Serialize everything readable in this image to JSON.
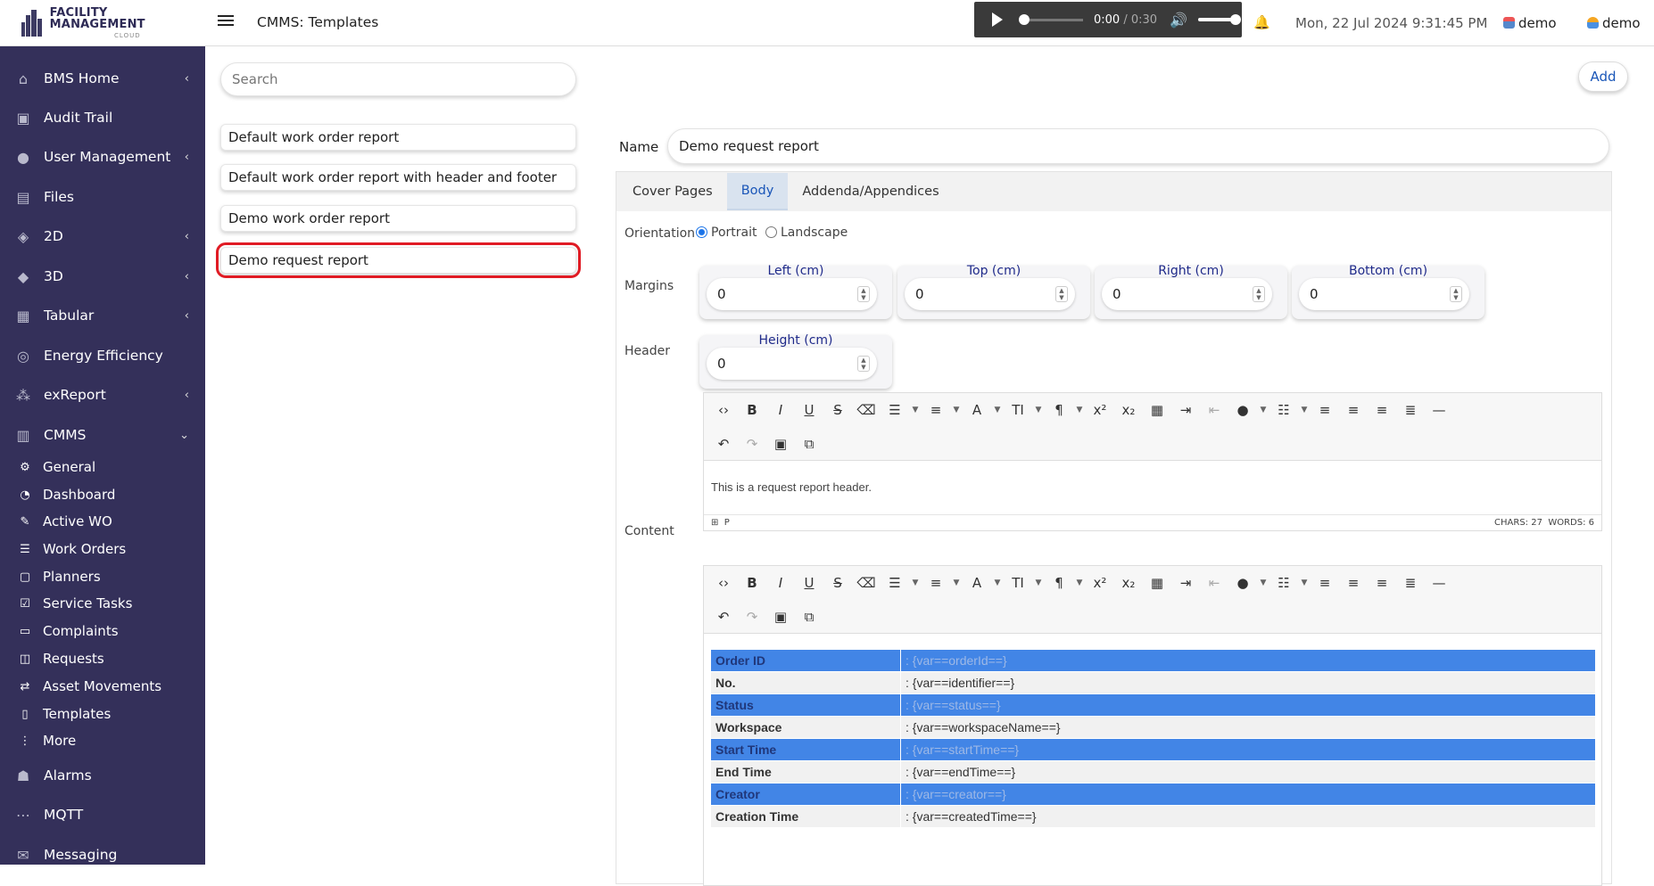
{
  "app": {
    "logo_text": "FACILITY MANAGEMENT",
    "logo_sub": "CLOUD",
    "page_title": "CMMS: Templates"
  },
  "sidebar": {
    "items": [
      {
        "label": "BMS Home",
        "icon": "home-icon",
        "chevron": true
      },
      {
        "label": "Audit Trail",
        "icon": "audit-icon",
        "chevron": false
      },
      {
        "label": "User Management",
        "icon": "users-icon",
        "chevron": true
      },
      {
        "label": "Files",
        "icon": "files-icon",
        "chevron": false
      },
      {
        "label": "2D",
        "icon": "layers-2d-icon",
        "chevron": true
      },
      {
        "label": "3D",
        "icon": "layers-3d-icon",
        "chevron": true
      },
      {
        "label": "Tabular",
        "icon": "table-icon",
        "chevron": true
      },
      {
        "label": "Energy Efficiency",
        "icon": "energy-icon",
        "chevron": false
      },
      {
        "label": "exReport",
        "icon": "report-icon",
        "chevron": true
      },
      {
        "label": "CMMS",
        "icon": "cmms-icon",
        "chevron": true
      }
    ],
    "cmms_sub": [
      {
        "label": "General",
        "icon": "cogs-icon"
      },
      {
        "label": "Dashboard",
        "icon": "dashboard-icon"
      },
      {
        "label": "Active WO",
        "icon": "wrench-icon"
      },
      {
        "label": "Work Orders",
        "icon": "list-icon"
      },
      {
        "label": "Planners",
        "icon": "calendar-icon"
      },
      {
        "label": "Service Tasks",
        "icon": "check-icon"
      },
      {
        "label": "Complaints",
        "icon": "complaint-icon"
      },
      {
        "label": "Requests",
        "icon": "request-icon"
      },
      {
        "label": "Asset Movements",
        "icon": "swap-icon"
      },
      {
        "label": "Templates",
        "icon": "template-icon"
      },
      {
        "label": "More",
        "icon": "more-icon"
      }
    ],
    "bottom": [
      {
        "label": "Alarms",
        "icon": "alarm-icon"
      },
      {
        "label": "MQTT",
        "icon": "mqtt-icon"
      },
      {
        "label": "Messaging",
        "icon": "messaging-icon"
      }
    ]
  },
  "audio": {
    "current": "0:00",
    "duration": "/ 0:30"
  },
  "header": {
    "datetime": "Mon, 22 Jul 2024 9:31:45 PM",
    "user1": "demo",
    "user2": "demo"
  },
  "templates": {
    "search_placeholder": "Search",
    "items": [
      "Default work order report",
      "Default work order report with header and footer",
      "Demo work order report",
      "Demo request report"
    ],
    "add_label": "Add"
  },
  "form": {
    "name_label": "Name",
    "name_value": "Demo request report",
    "tabs": [
      "Cover Pages",
      "Body",
      "Addenda/Appendices"
    ],
    "orientation_label": "Orientation",
    "orientation_options": [
      "Portrait",
      "Landscape"
    ],
    "margins_label": "Margins",
    "margins": [
      {
        "label": "Left (cm)",
        "value": "0"
      },
      {
        "label": "Top (cm)",
        "value": "0"
      },
      {
        "label": "Right (cm)",
        "value": "0"
      },
      {
        "label": "Bottom (cm)",
        "value": "0"
      }
    ],
    "header_label": "Header",
    "header_height": {
      "label": "Height (cm)",
      "value": "0"
    },
    "header_text": "This is a request report header.",
    "header_status": {
      "path": "P",
      "chars": "CHARS: 27",
      "words": "WORDS: 6"
    },
    "content_label": "Content",
    "content_rows": [
      {
        "key": "Order ID",
        "value": ": {var==orderId==}"
      },
      {
        "key": "No.",
        "value": ": {var==identifier==}"
      },
      {
        "key": "Status",
        "value": ": {var==status==}"
      },
      {
        "key": "Workspace",
        "value": ": {var==workspaceName==}"
      },
      {
        "key": "Start Time",
        "value": ": {var==startTime==}"
      },
      {
        "key": "End Time",
        "value": ": {var==endTime==}"
      },
      {
        "key": "Creator",
        "value": ": {var==creator==}"
      },
      {
        "key": "Creation Time",
        "value": ": {var==createdTime==}"
      }
    ]
  }
}
